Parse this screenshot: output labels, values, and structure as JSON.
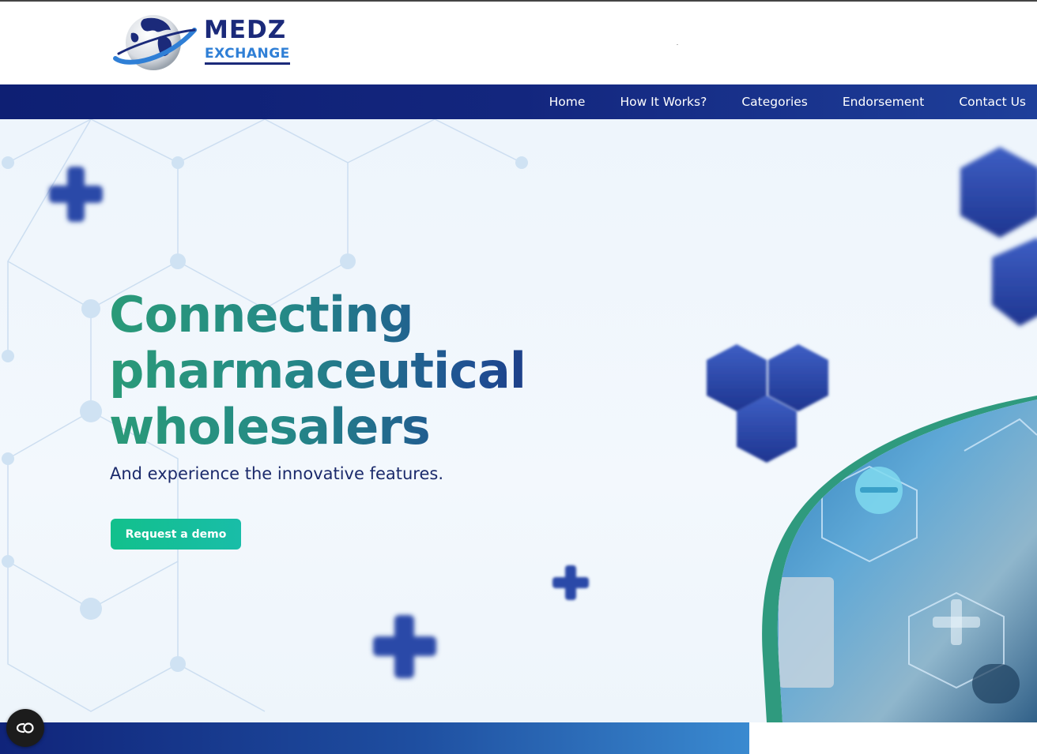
{
  "brand": {
    "name_top": "MEDZ",
    "name_bottom": "EXCHANGE",
    "logo_icon": "globe-icon",
    "colors": {
      "navy": "#1b2a7a",
      "blue": "#2f7fd6",
      "green": "#12c08c"
    }
  },
  "nav": {
    "items": [
      {
        "label": "Home"
      },
      {
        "label": "How It Works?"
      },
      {
        "label": "Categories"
      },
      {
        "label": "Endorsement"
      },
      {
        "label": "Contact Us"
      }
    ]
  },
  "hero": {
    "headline_lines": [
      "Connecting",
      "pharmaceutical",
      "wholesalers"
    ],
    "subtitle": "And experience the innovative features.",
    "cta_label": "Request a demo"
  },
  "cookie_button": {
    "icon": "cookie-consent-icon"
  }
}
